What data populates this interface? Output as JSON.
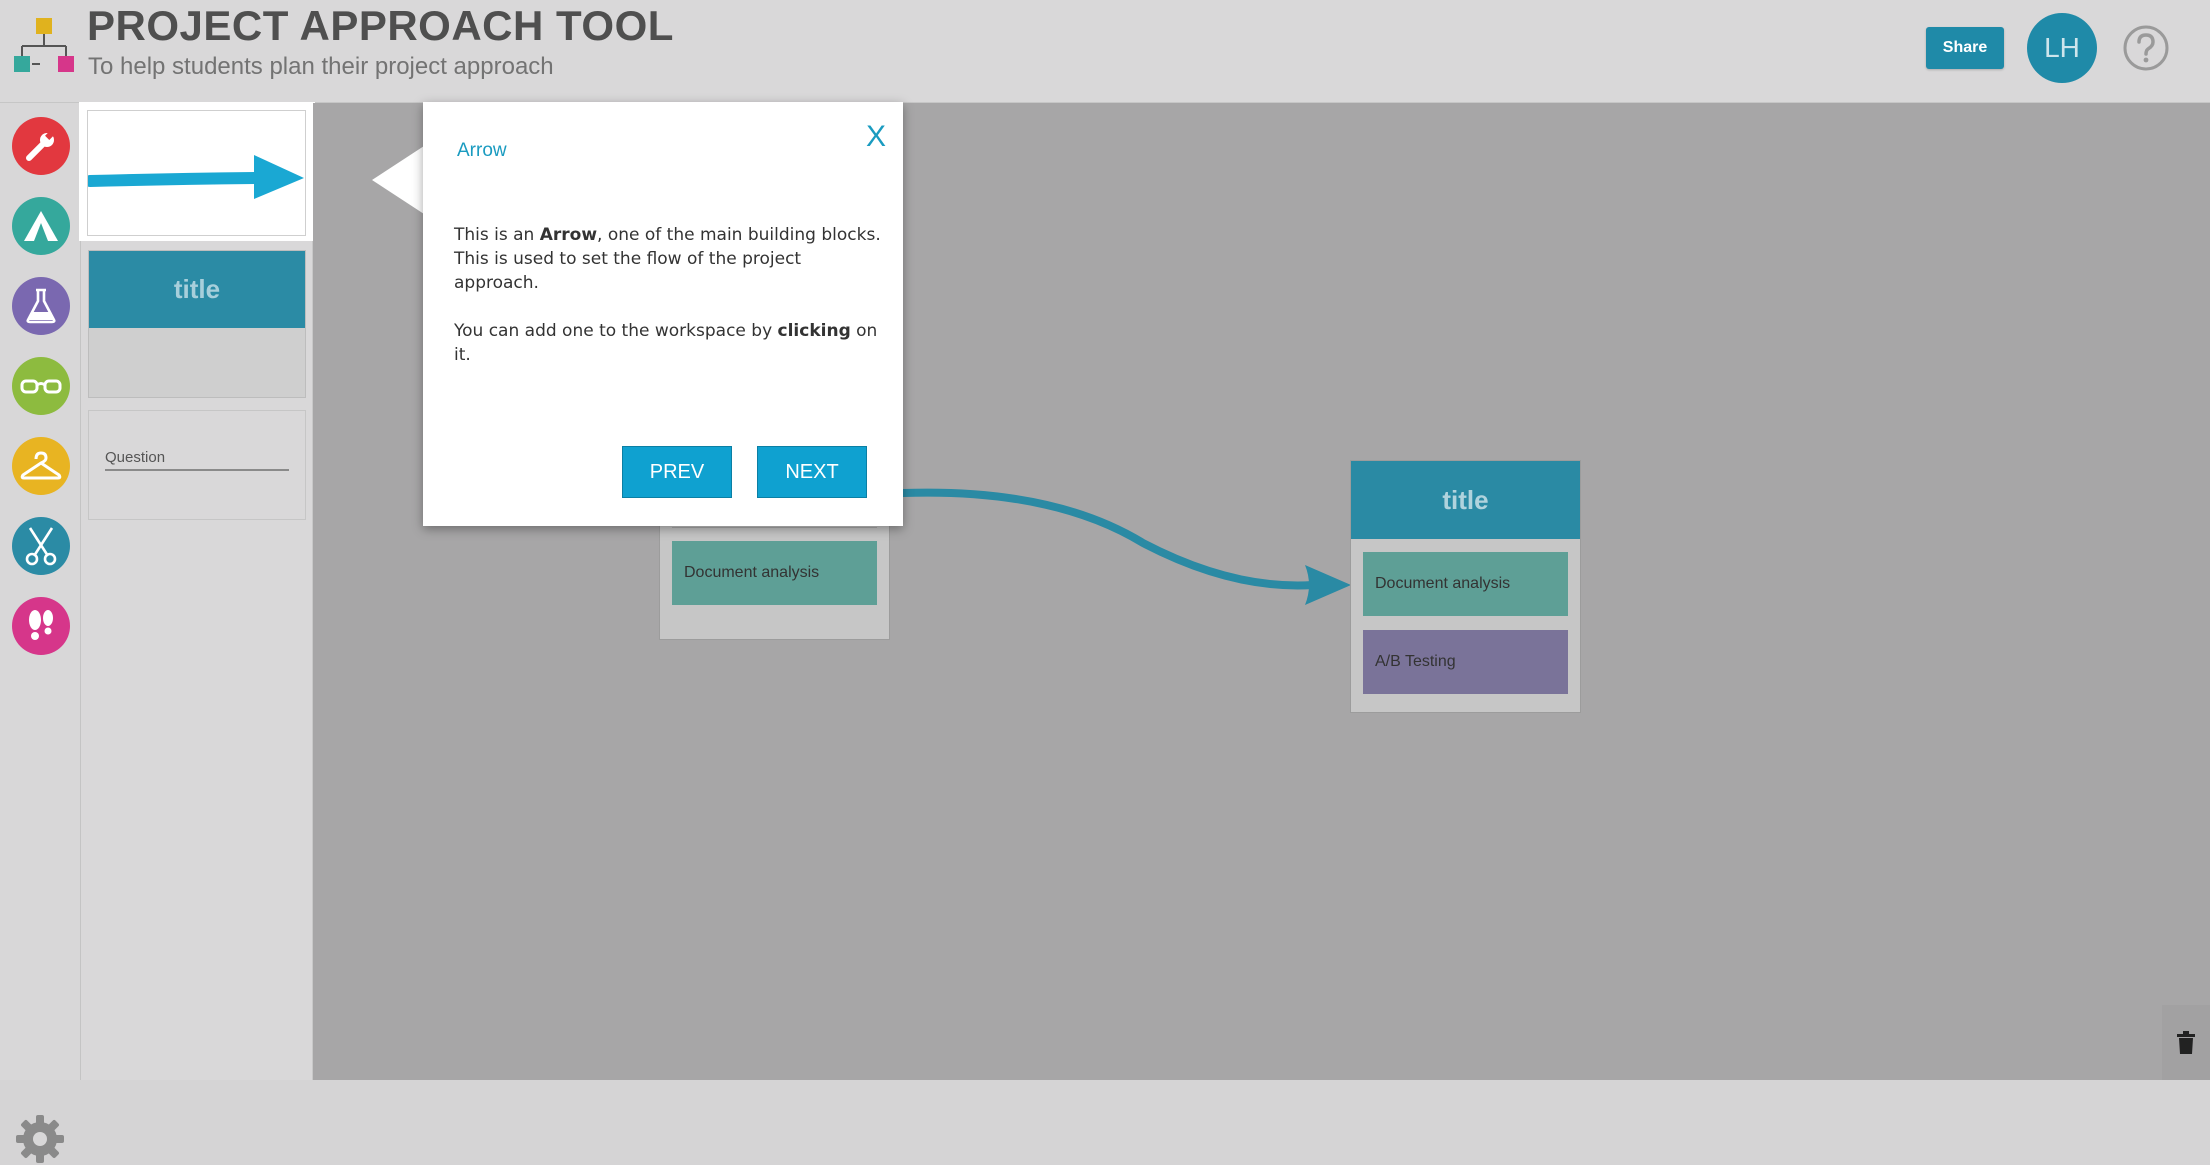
{
  "header": {
    "title": "PROJECT APPROACH TOOL",
    "subtitle": "To help students plan their project approach",
    "share_label": "Share",
    "avatar_initials": "LH",
    "help_icon": "question-circle-icon"
  },
  "colors": {
    "accent": "#1f8aa8",
    "dialog_accent": "#1a9bc0",
    "button": "#0fa1d0",
    "categories": [
      "#e2383f",
      "#35a89c",
      "#7a68b0",
      "#8dbb3f",
      "#e8b422",
      "#2b8ba5",
      "#d6368a"
    ]
  },
  "sidebar": {
    "categories": [
      {
        "icon": "wrench-icon",
        "color": "#e2383f"
      },
      {
        "icon": "tent-icon",
        "color": "#35a89c"
      },
      {
        "icon": "flask-icon",
        "color": "#7a68b0"
      },
      {
        "icon": "glasses-icon",
        "color": "#8dbb3f"
      },
      {
        "icon": "hanger-icon",
        "color": "#e8b422"
      },
      {
        "icon": "scissors-icon",
        "color": "#2b8ba5"
      },
      {
        "icon": "footprints-icon",
        "color": "#d6368a"
      }
    ],
    "settings_icon": "gear-icon"
  },
  "palette": {
    "block_title": "title",
    "question_label": "Question"
  },
  "workspace": {
    "blocks": [
      {
        "title": "title",
        "items": [
          "Document analysis",
          "A/B Testing"
        ]
      }
    ],
    "partial_block_item": "Document analysis"
  },
  "dialog": {
    "title": "Arrow",
    "close_label": "X",
    "line1_pre": "This is an ",
    "line1_bold": "Arrow",
    "line1_post": ", one of the main building blocks.",
    "line2": "This is used to set the flow of the project approach.",
    "line3_pre": "You can add one to the workspace by ",
    "line3_bold": "clicking",
    "line3_post": " on it.",
    "prev_label": "PREV",
    "next_label": "NEXT"
  }
}
